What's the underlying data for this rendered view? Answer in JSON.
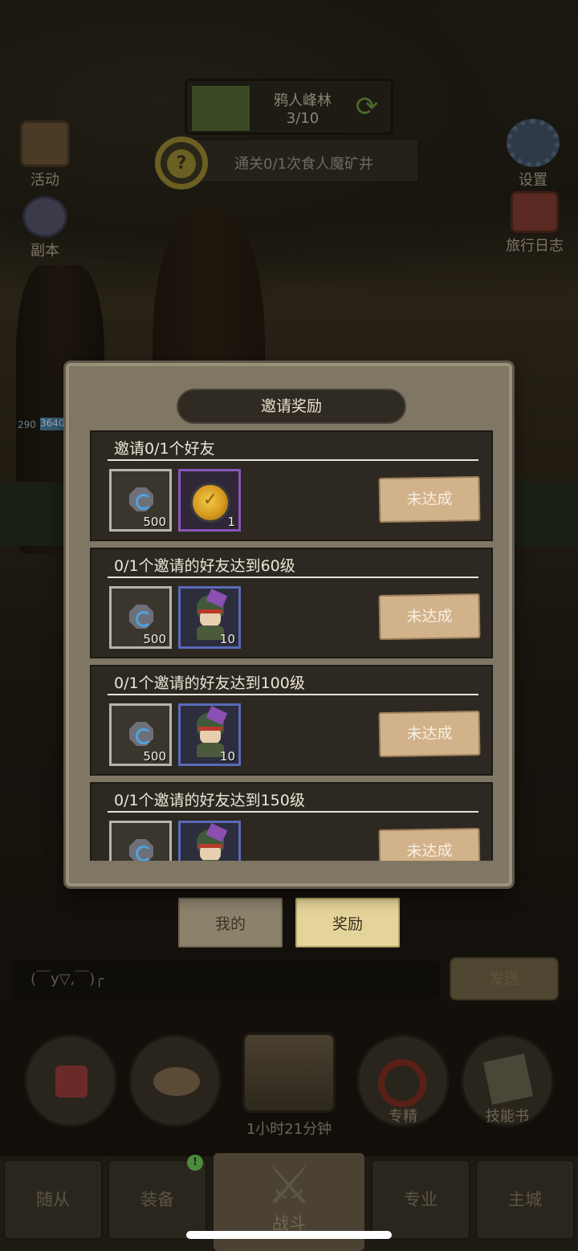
{
  "hud": {
    "map_name": "鸦人峰林",
    "map_progress": "3/10",
    "quest_text": "通关0/1次食人魔矿井",
    "quest_icon": "?",
    "left_buttons": [
      {
        "label": "活动",
        "icon": "scroll-icon"
      },
      {
        "label": "副本",
        "icon": "portal-icon"
      }
    ],
    "right_buttons": [
      {
        "label": "设置",
        "icon": "gear-icon"
      },
      {
        "label": "旅行日志",
        "icon": "journal-icon"
      }
    ],
    "hp_level": "290",
    "hp_value": "3640"
  },
  "modal": {
    "title": "邀请奖励",
    "tasks": [
      {
        "title": "邀请0/1个好友",
        "rewards": [
          {
            "type": "stone",
            "count": "500"
          },
          {
            "type": "coin",
            "count": "1"
          }
        ],
        "status": "未达成"
      },
      {
        "title": "0/1个邀请的好友达到60级",
        "rewards": [
          {
            "type": "stone",
            "count": "500"
          },
          {
            "type": "hero",
            "count": "10"
          }
        ],
        "status": "未达成"
      },
      {
        "title": "0/1个邀请的好友达到100级",
        "rewards": [
          {
            "type": "stone",
            "count": "500"
          },
          {
            "type": "hero",
            "count": "10"
          }
        ],
        "status": "未达成"
      },
      {
        "title": "0/1个邀请的好友达到150级",
        "rewards": [
          {
            "type": "stone",
            "count": ""
          },
          {
            "type": "hero",
            "count": ""
          }
        ],
        "status": "未达成"
      }
    ]
  },
  "tabs": {
    "mine": "我的",
    "reward": "奖励"
  },
  "chat": {
    "input_value": "(￣y▽,￣)╭",
    "send_label": "发送"
  },
  "actions": {
    "chest_timer": "1小时21分钟",
    "items": [
      {
        "label": "",
        "icon": "potion-icon"
      },
      {
        "label": "",
        "icon": "bread-icon"
      },
      {
        "label": "专精",
        "icon": "mastery-icon"
      },
      {
        "label": "技能书",
        "icon": "skillbook-icon"
      }
    ]
  },
  "nav": {
    "items": [
      "随从",
      "装备",
      "战斗",
      "专业",
      "主城"
    ],
    "badge": "!"
  },
  "colors": {
    "modal_bg": "#7f7764",
    "task_bg": "#2d2922",
    "status_button": "#d2b28a",
    "reward_tab_active": "#e5d49a"
  }
}
